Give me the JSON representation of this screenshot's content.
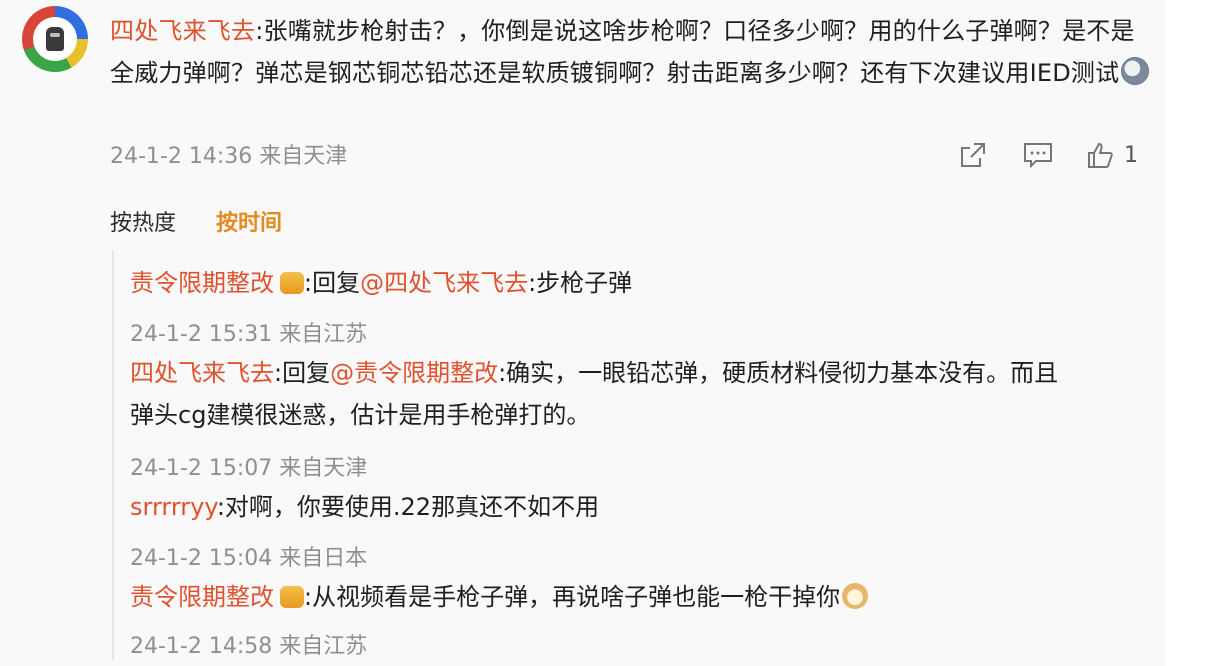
{
  "main_comment": {
    "username": "四处飞来飞去",
    "text": ":张嘴就步枪射击？，你倒是说这啥步枪啊？口径多少啊？用的什么子弹啊？是不是全威力弹啊？弹芯是钢芯铜芯铅芯还是软质镀铜啊？射击距离多少啊？还有下次建议用IED测试",
    "emoji": "face-emoji",
    "timestamp": "24-1-2 14:36 来自天津",
    "like_count": "1"
  },
  "sort": {
    "hot_label": "按热度",
    "time_label": "按时间"
  },
  "replies": [
    {
      "username": "责令限期整改",
      "badge": "crown-badge",
      "prefix": ":回复",
      "mention": "@四处飞来飞去",
      "text": ":步枪子弹",
      "timestamp": "24-1-2 15:31 来自江苏"
    },
    {
      "username": "四处飞来飞去",
      "prefix": ":回复",
      "mention": "@责令限期整改",
      "text_line1": ":确实，一眼铅芯弹，硬质材料侵彻力基本没有。而且",
      "text_line2": "弹头cg建模很迷惑，估计是用手枪弹打的。",
      "timestamp": "24-1-2 15:07 来自天津"
    },
    {
      "username": "srrrrryy",
      "text": ":对啊，你要使用.22那真还不如不用",
      "timestamp": "24-1-2 15:04 来自日本"
    },
    {
      "username": "责令限期整改",
      "badge": "crown-badge",
      "text": ":从视频看是手枪子弹，再说啥子弹也能一枪干掉你",
      "emoji": "dog-emoji",
      "timestamp": "24-1-2 14:58 来自江苏"
    }
  ]
}
